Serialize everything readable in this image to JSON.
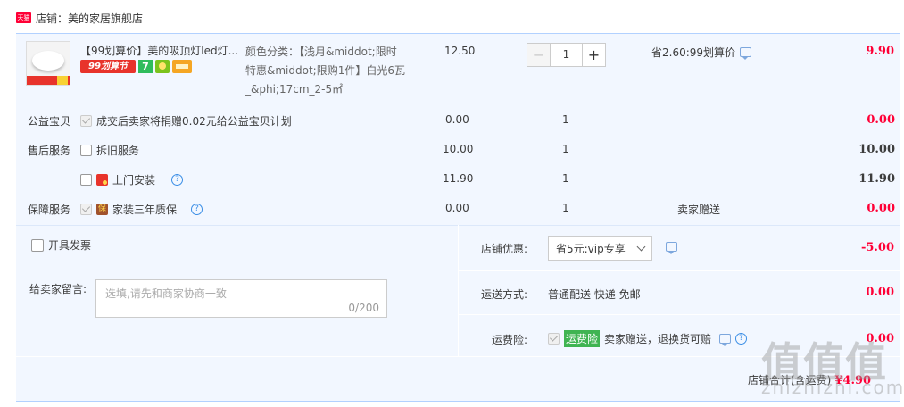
{
  "shop": {
    "label": "店铺：美的家居旗舰店",
    "tmall_badge": "天猫"
  },
  "item": {
    "title": "【99划算价】美的吸顶灯led灯...",
    "badges": {
      "promo": "99划算节",
      "seven": "7"
    },
    "sku_lines": [
      "颜色分类：【浅月&middot;限时",
      "特惠&middot;限购1件】白光6瓦",
      "_&phi;17cm_2-5㎡"
    ],
    "price": "12.50",
    "quantity": "1",
    "minus": "−",
    "plus": "+",
    "savings": "省2.60:99划算价",
    "total": "9.90"
  },
  "services": [
    {
      "label": "公益宝贝",
      "text": "成交后卖家将捐赠0.02元给公益宝贝计划",
      "price": "0.00",
      "qty": "1",
      "note": "",
      "total": "0.00",
      "total_color": "red"
    },
    {
      "label": "售后服务",
      "text": "拆旧服务",
      "price": "10.00",
      "qty": "1",
      "note": "",
      "total": "10.00",
      "total_color": "dark"
    },
    {
      "label": "",
      "text": "上门安装",
      "price": "11.90",
      "qty": "1",
      "note": "",
      "total": "11.90",
      "total_color": "dark"
    },
    {
      "label": "保障服务",
      "text": "家装三年质保",
      "price": "0.00",
      "qty": "1",
      "note": "卖家赠送",
      "total": "0.00",
      "total_color": "red"
    }
  ],
  "invoice": {
    "label": "开具发票"
  },
  "note": {
    "label": "给卖家留言:",
    "placeholder": "选填,请先和商家协商一致",
    "count": "0/200"
  },
  "discount": {
    "label": "店铺优惠:",
    "selected": "省5元:vip专享",
    "amount": "-5.00"
  },
  "shipping": {
    "label": "运送方式:",
    "value": "普通配送 快递 免邮",
    "amount": "0.00"
  },
  "insurance": {
    "label": "运费险:",
    "badge": "运费险",
    "text": "卖家赠送，退换货可赔",
    "amount": "0.00"
  },
  "summary": {
    "label": "店铺合计(含运费)",
    "amount": "¥4.90"
  },
  "watermark": {
    "main": "值值值",
    "sub": "zhizhizhi.com"
  },
  "colors": {
    "accent_red": "#ff0036",
    "light_blue": "#f2f7ff",
    "border_blue": "#b2d1ff",
    "insurance_green": "#3fb452"
  }
}
